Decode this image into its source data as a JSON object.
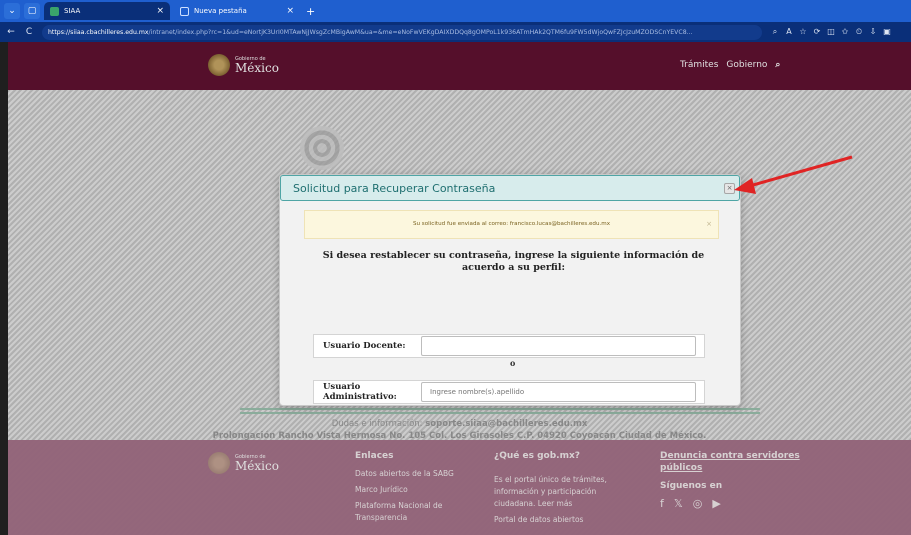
{
  "browser": {
    "tabs": [
      {
        "title": "SIAA",
        "close": "×",
        "active": true
      },
      {
        "title": "Nueva pestaña",
        "close": "×",
        "active": false
      }
    ],
    "newtab": "+",
    "url_host": "https://siiaa.cbachilleres.edu.mx",
    "url_path": "/intranet/index.php?rc=1&ud=eNortjK3UrI0MTAwNjJWsgZcMBigAwM&ua=&me=eNoFwVEKgDAIXDDQq8gOMPoL1k936ATmHAk2QTM6fu9FW5dWjoQwFZJcJzuMZODSCnYEVC8...",
    "nav": {
      "back": "←",
      "reload": "C"
    },
    "tools": [
      "⌕",
      "A",
      "☆",
      "⟳",
      "◫",
      "✩",
      "⏲",
      "⇩",
      "▣"
    ]
  },
  "site": {
    "logo": {
      "line1": "Gobierno de",
      "line2": "México"
    },
    "nav": {
      "item1": "Trámites",
      "item2": "Gobierno",
      "search": "⌕"
    }
  },
  "modal": {
    "title": "Solicitud para Recuperar Contraseña",
    "close": "×",
    "alert": "Su solicitud fue enviada al correo: francisco.lucas@bachilleres.edu.mx",
    "alert_close": "×",
    "instructions": "Si desea restablecer su contraseña, ingrese la siguiente información de acuerdo a su perfil:",
    "field1_label": "Usuario Docente:",
    "field1_value": "",
    "separator": "o",
    "field2_label": "Usuario Administrativo:",
    "field2_placeholder": "Ingrese nombre(s).apellido"
  },
  "contact": {
    "line1_prefix": "Dudas e información: ",
    "line1_email": "soporte.siiaa@bachilleres.edu.mx",
    "line2": "Prolongación Rancho Vista Hermosa No. 105 Col. Los Girasoles C.P. 04920 Coyoacán Ciudad de México."
  },
  "footer": {
    "logo": {
      "line1": "Gobierno de",
      "line2": "México"
    },
    "enlaces": {
      "heading": "Enlaces",
      "items": [
        "Datos abiertos de la SABG",
        "Marco Jurídico",
        "Plataforma Nacional de",
        "Transparencia"
      ]
    },
    "que_es": {
      "heading": "¿Qué es gob.mx?",
      "text1": "Es el portal único de trámites,",
      "text2": "información y participación",
      "text3": "ciudadana. Leer más",
      "text4": "Portal de datos abiertos"
    },
    "denuncia": {
      "heading1": "Denuncia contra servidores",
      "heading2": "públicos",
      "follow": "Síguenos en",
      "icons": [
        "f",
        "𝕏",
        "◎",
        "▶"
      ]
    }
  },
  "colors": {
    "header": "#611232",
    "modal_head": "#d7ecec",
    "modal_border": "#4fa5a5",
    "alert_bg": "#fcf7de",
    "arrow": "#e02424"
  }
}
